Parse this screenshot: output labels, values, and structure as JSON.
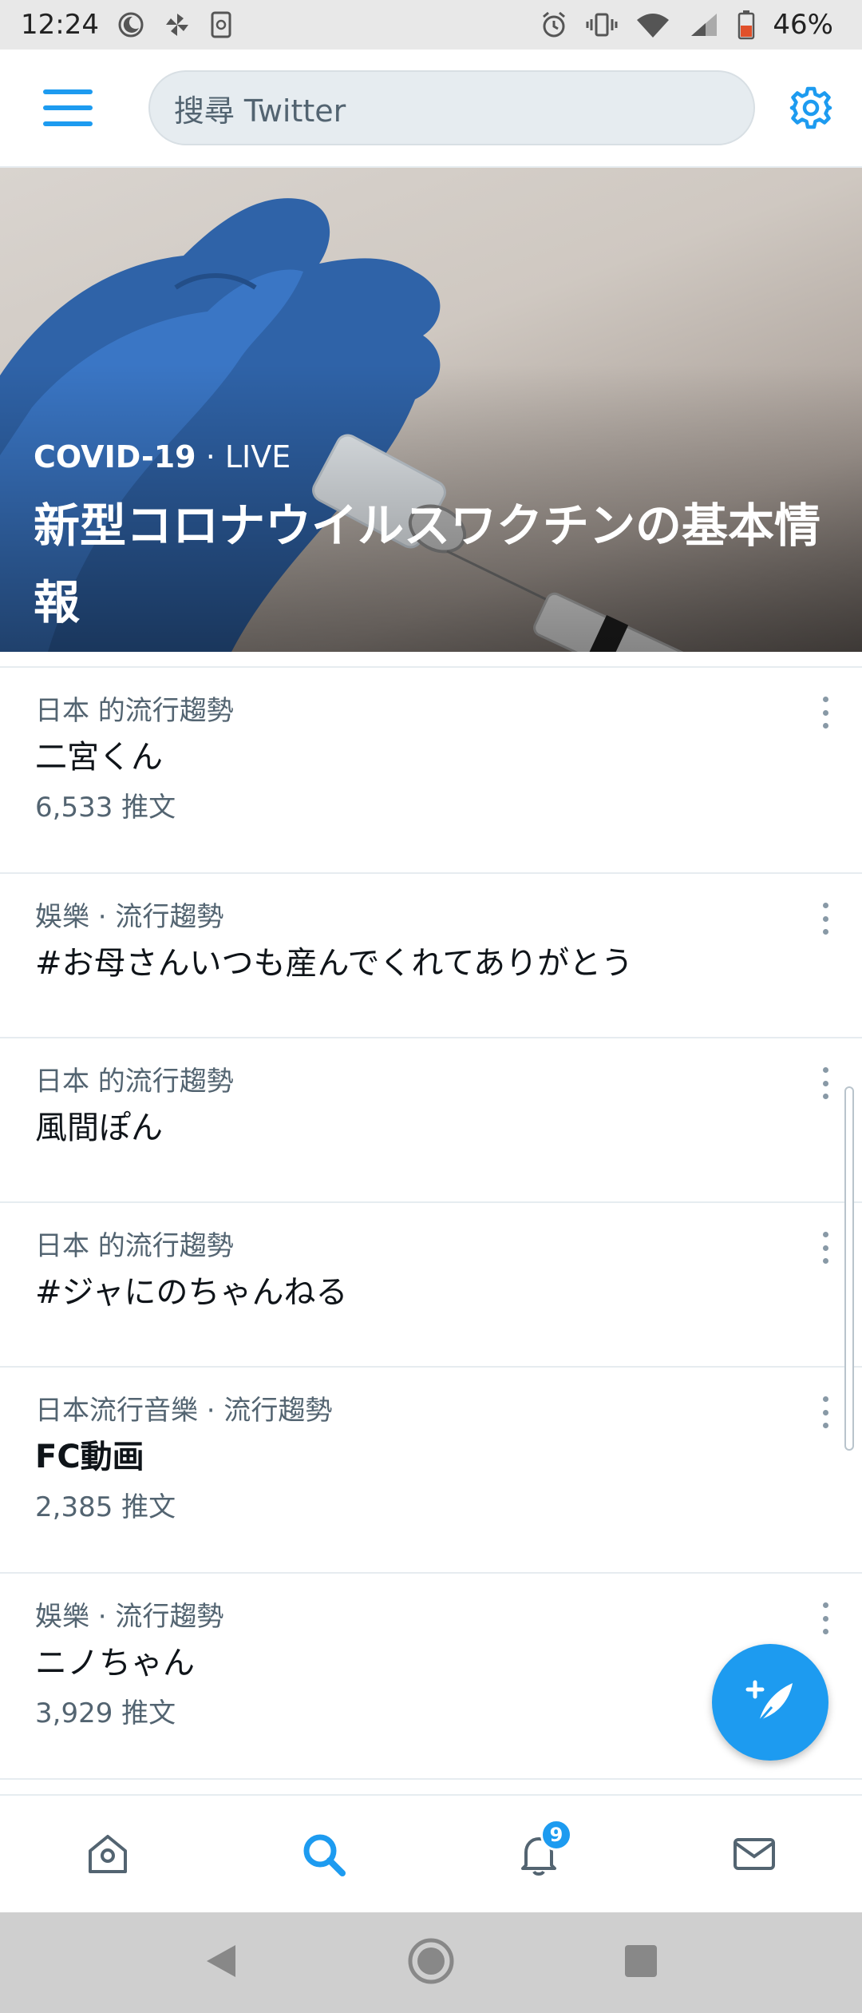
{
  "status_bar": {
    "time": "12:24",
    "battery": "46%",
    "icons": [
      "moon-icon",
      "pinwheel-icon",
      "sync-icon",
      "alarm-icon",
      "vibrate-icon",
      "wifi-icon",
      "signal-icon",
      "battery-icon"
    ]
  },
  "header": {
    "search_placeholder": "搜尋 Twitter",
    "menu_icon": "menu-icon",
    "settings_icon": "gear-icon"
  },
  "hero": {
    "topic": "COVID-19",
    "separator": " · ",
    "live": "LIVE",
    "title": "新型コロナウイルスワクチンの基本情報"
  },
  "trends": [
    {
      "meta": "日本 的流行趨勢",
      "name": "二宮くん",
      "count": "6,533 推文"
    },
    {
      "meta": "娛樂 · 流行趨勢",
      "name": "#お母さんいつも産んでくれてありがとう",
      "count": ""
    },
    {
      "meta": "日本 的流行趨勢",
      "name": "風間ぽん",
      "count": ""
    },
    {
      "meta": "日本 的流行趨勢",
      "name": "#ジャにのちゃんねる",
      "count": ""
    },
    {
      "meta": "日本流行音樂 · 流行趨勢",
      "name": "FC動画",
      "count": "2,385 推文"
    },
    {
      "meta": "娛樂 · 流行趨勢",
      "name": "ニノちゃん",
      "count": "3,929 推文"
    }
  ],
  "bottom_nav": {
    "items": [
      "home-icon",
      "search-icon",
      "bell-icon",
      "mail-icon"
    ],
    "notification_badge": "9"
  },
  "colors": {
    "accent": "#1d9bf0",
    "secondary_text": "#536471",
    "divider": "#e6ecf0"
  }
}
